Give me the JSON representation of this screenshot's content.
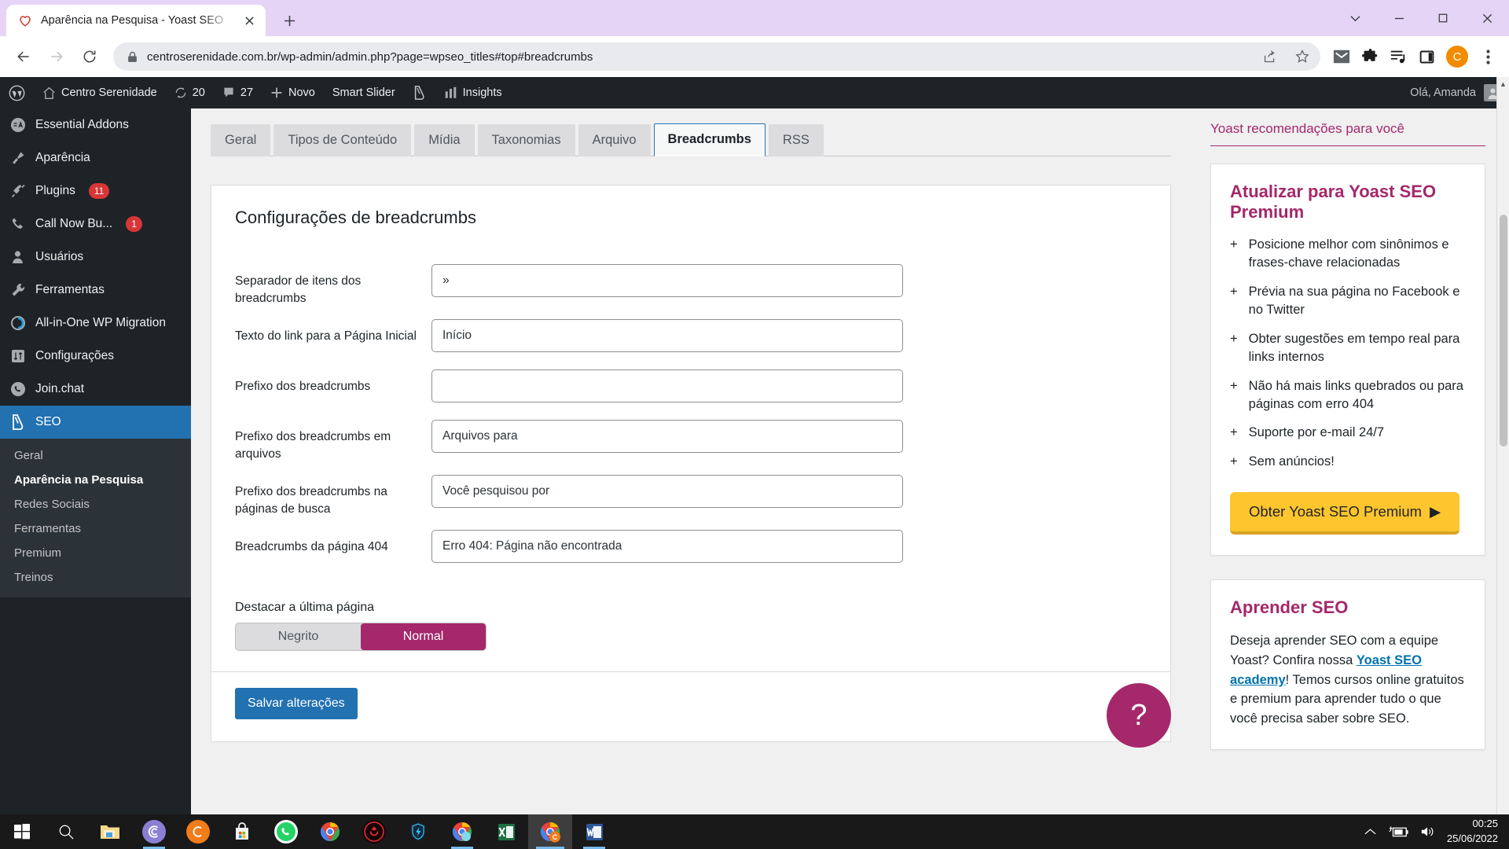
{
  "browser": {
    "tab": {
      "title": "Aparência na Pesquisa - Yoast SEO",
      "favicon_icon": "heart-logo-icon",
      "close_icon": "close-icon",
      "newtab_icon": "plus-icon"
    },
    "window_controls": {
      "minimize_icon": "chevron-down-icon",
      "restore_icon": "minimize-icon",
      "maximize_icon": "maximize-icon",
      "close_icon": "close-icon"
    },
    "nav": {
      "back_icon": "back-arrow-icon",
      "forward_icon": "forward-arrow-icon",
      "reload_icon": "reload-icon"
    },
    "omnibox": {
      "lock_icon": "lock-icon",
      "url": "centroserenidade.com.br/wp-admin/admin.php?page=wpseo_titles#top#breadcrumbs",
      "share_icon": "share-icon",
      "bookmark_icon": "star-icon"
    },
    "extensions": [
      {
        "name": "gmail-icon",
        "glyph": "M"
      },
      {
        "name": "puzzle-extensions-icon",
        "glyph": ""
      },
      {
        "name": "playlist-music-icon",
        "glyph": ""
      },
      {
        "name": "side-panel-icon",
        "glyph": ""
      }
    ],
    "profile_initial": "C",
    "menu_icon": "three-dot-menu-icon"
  },
  "adminbar": {
    "wp_logo_icon": "wordpress-logo-icon",
    "site_name": "Centro Serenidade",
    "home_icon": "home-icon",
    "updates_icon": "updates-icon",
    "updates_count": "20",
    "comments_icon": "comment-icon",
    "comments_count": "27",
    "new_icon": "plus-icon",
    "new_label": "Novo",
    "smart_slider_label": "Smart Slider",
    "yoast_icon": "yoast-logo-icon",
    "insights_icon": "bar-chart-icon",
    "insights_label": "Insights",
    "greeting": "Olá, Amanda",
    "avatar_icon": "user-avatar-icon"
  },
  "sidebar": {
    "items": [
      {
        "label": "Essential Addons",
        "icon": "essential-addons-icon",
        "badge": ""
      },
      {
        "label": "Aparência",
        "icon": "paintbrush-icon",
        "badge": ""
      },
      {
        "label": "Plugins",
        "icon": "plug-icon",
        "badge": "11"
      },
      {
        "label": "Call Now Bu...",
        "icon": "phone-icon",
        "badge": "1"
      },
      {
        "label": "Usuários",
        "icon": "user-icon",
        "badge": ""
      },
      {
        "label": "Ferramentas",
        "icon": "wrench-icon",
        "badge": ""
      },
      {
        "label": "All-in-One WP Migration",
        "icon": "migration-icon",
        "badge": ""
      },
      {
        "label": "Configurações",
        "icon": "settings-sliders-icon",
        "badge": ""
      },
      {
        "label": "Join.chat",
        "icon": "whatsapp-icon",
        "badge": ""
      }
    ],
    "current": {
      "label": "SEO",
      "icon": "yoast-logo-icon"
    },
    "submenu": [
      {
        "label": "Geral",
        "active": false
      },
      {
        "label": "Aparência na Pesquisa",
        "active": true
      },
      {
        "label": "Redes Sociais",
        "active": false
      },
      {
        "label": "Ferramentas",
        "active": false
      },
      {
        "label": "Premium",
        "active": false
      },
      {
        "label": "Treinos",
        "active": false
      }
    ]
  },
  "tabs": [
    {
      "label": "Geral",
      "active": false
    },
    {
      "label": "Tipos de Conteúdo",
      "active": false
    },
    {
      "label": "Mídia",
      "active": false
    },
    {
      "label": "Taxonomias",
      "active": false
    },
    {
      "label": "Arquivo",
      "active": false
    },
    {
      "label": "Breadcrumbs",
      "active": true
    },
    {
      "label": "RSS",
      "active": false
    }
  ],
  "panel": {
    "title": "Configurações de breadcrumbs",
    "fields": [
      {
        "label": "Separador de itens dos breadcrumbs",
        "value": "»"
      },
      {
        "label": "Texto do link para a Página Inicial",
        "value": "Início"
      },
      {
        "label": "Prefixo dos breadcrumbs",
        "value": ""
      },
      {
        "label": "Prefixo dos breadcrumbs em arquivos",
        "value": "Arquivos para"
      },
      {
        "label": "Prefixo dos breadcrumbs na páginas de busca",
        "value": "Você pesquisou por"
      },
      {
        "label": "Breadcrumbs da página 404",
        "value": "Erro 404: Página não encontrada"
      }
    ],
    "bold_group": {
      "legend": "Destacar a última página",
      "options": [
        {
          "label": "Negrito",
          "selected": false
        },
        {
          "label": "Normal",
          "selected": true
        }
      ]
    },
    "save_label": "Salvar alterações"
  },
  "yoast_sidebar": {
    "heading": "Yoast recomendações para você",
    "premium_card": {
      "title": "Atualizar para Yoast SEO Premium",
      "bullets": [
        "Posicione melhor com sinônimos e frases-chave relacionadas",
        "Prévia na sua página no Facebook e no Twitter",
        "Obter sugestões em tempo real para links internos",
        "Não há mais links quebrados ou para páginas com erro 404",
        "Suporte por e-mail 24/7",
        "Sem anúncios!"
      ],
      "cta_label": "Obter Yoast SEO Premium",
      "cta_arrow_icon": "play-triangle-icon"
    },
    "learn_card": {
      "title": "Aprender SEO",
      "text_before": "Deseja aprender SEO com a equipe Yoast? Confira nossa ",
      "link": "Yoast SEO academy",
      "text_after": "! Temos cursos online gratuitos e premium para aprender tudo o que você precisa saber sobre SEO."
    },
    "help_icon": "question-mark-icon"
  },
  "colors": {
    "yoast_purple": "#a4286a",
    "wp_blue": "#2271b1",
    "premium_yellow": "#ffc52e",
    "badge_red": "#d63638",
    "tab_strip": "#e6d4f7"
  },
  "taskbar": {
    "start_icon": "windows-start-icon",
    "search_icon": "search-icon",
    "apps": [
      {
        "name": "file-explorer-icon",
        "glyph": ""
      },
      {
        "name": "bittorrent-icon",
        "glyph": "C"
      },
      {
        "name": "orange-c-app-icon",
        "glyph": "C"
      },
      {
        "name": "microsoft-store-icon",
        "glyph": ""
      },
      {
        "name": "whatsapp-icon",
        "glyph": ""
      },
      {
        "name": "chrome-icon",
        "glyph": ""
      },
      {
        "name": "red-circle-app-icon",
        "glyph": ""
      },
      {
        "name": "vpn-shield-icon",
        "glyph": ""
      },
      {
        "name": "chrome-secondary-icon",
        "glyph": ""
      },
      {
        "name": "excel-icon",
        "glyph": "X"
      },
      {
        "name": "chrome-active-icon",
        "glyph": ""
      },
      {
        "name": "word-icon",
        "glyph": "W"
      }
    ],
    "tray": {
      "chevron_icon": "chevron-up-icon",
      "battery_icon": "battery-charging-icon",
      "volume_icon": "volume-icon"
    },
    "time": "00:25",
    "date": "25/06/2022"
  }
}
